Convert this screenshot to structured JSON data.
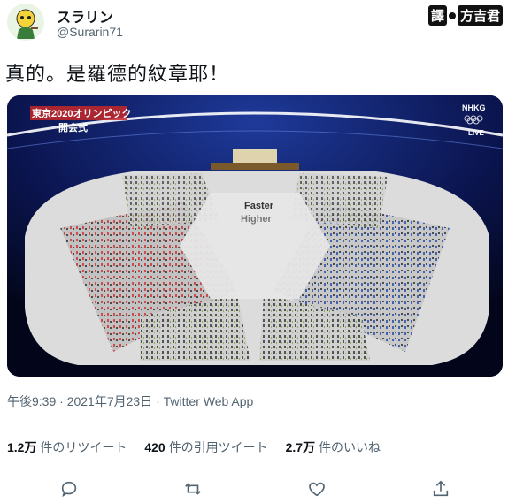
{
  "user": {
    "display_name": "スラリン",
    "handle": "@Surarin71"
  },
  "translator_badge": {
    "prefix": "譯",
    "name": "方吉君"
  },
  "tweet": {
    "text": "真的。是羅德的紋章耶！",
    "timestamp": "午後9:39 · 2021年7月23日 · Twitter Web App"
  },
  "media": {
    "overlay_title": "東京2020オリンピック",
    "overlay_subtitle": "開会式",
    "broadcaster": "NHKG",
    "live_label": "LIVE",
    "field_text_1": "Faster",
    "field_text_2": "Higher"
  },
  "stats": {
    "retweets_count": "1.2万",
    "retweets_label": "件のリツイート",
    "quotes_count": "420",
    "quotes_label": "件の引用ツイート",
    "likes_count": "2.7万",
    "likes_label": "件のいいね"
  },
  "actions": [
    "reply-icon",
    "retweet-icon",
    "like-icon",
    "share-icon"
  ]
}
